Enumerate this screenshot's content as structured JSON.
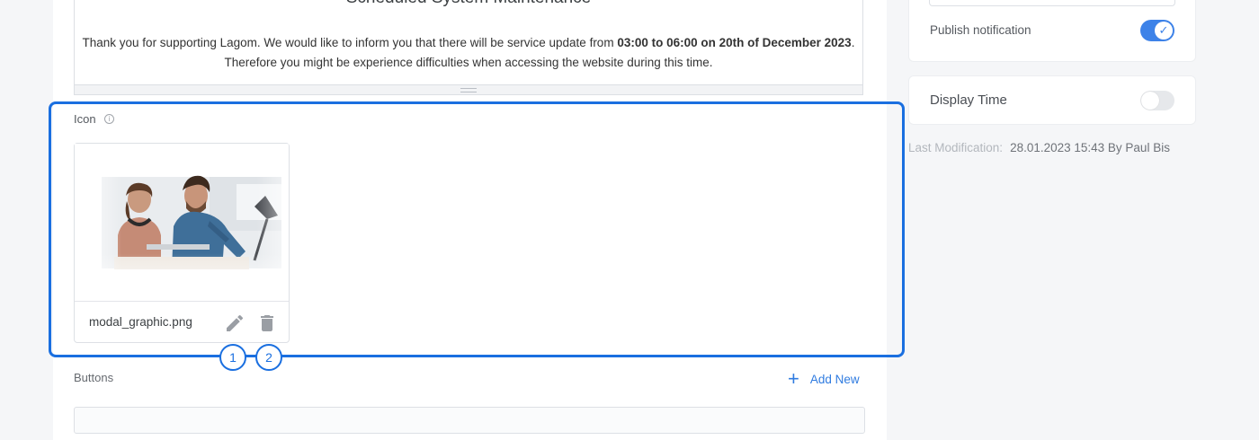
{
  "editor": {
    "title": "Scheduled System Maintenance",
    "body_part1": "Thank you for supporting Lagom. We would like to inform you that there will be service update from ",
    "body_bold1": "03:00 to 06:00 on 20th of December 2023",
    "body_part2": ". Therefore you might be experience  difficulties when accessing the website during this time."
  },
  "icon_section": {
    "label": "Icon",
    "info_glyph": "i",
    "file_name": "modal_graphic.png",
    "icons": [
      "info-icon",
      "pencil-icon",
      "trash-icon"
    ]
  },
  "badges": [
    "1",
    "2"
  ],
  "buttons_section": {
    "label": "Buttons",
    "add_new": "Add New",
    "add_glyph": "+"
  },
  "sidebar": {
    "publish_label": "Publish notification",
    "publish_on": true,
    "display_time_label": "Display Time",
    "display_time_on": false,
    "last_mod_label": "Last Modification:",
    "last_mod_value": "28.01.2023 15:43 By Paul Bis"
  },
  "colors": {
    "accent": "#1a6fe0",
    "toggle_on": "#3d82e8",
    "link": "#2f7be0"
  }
}
